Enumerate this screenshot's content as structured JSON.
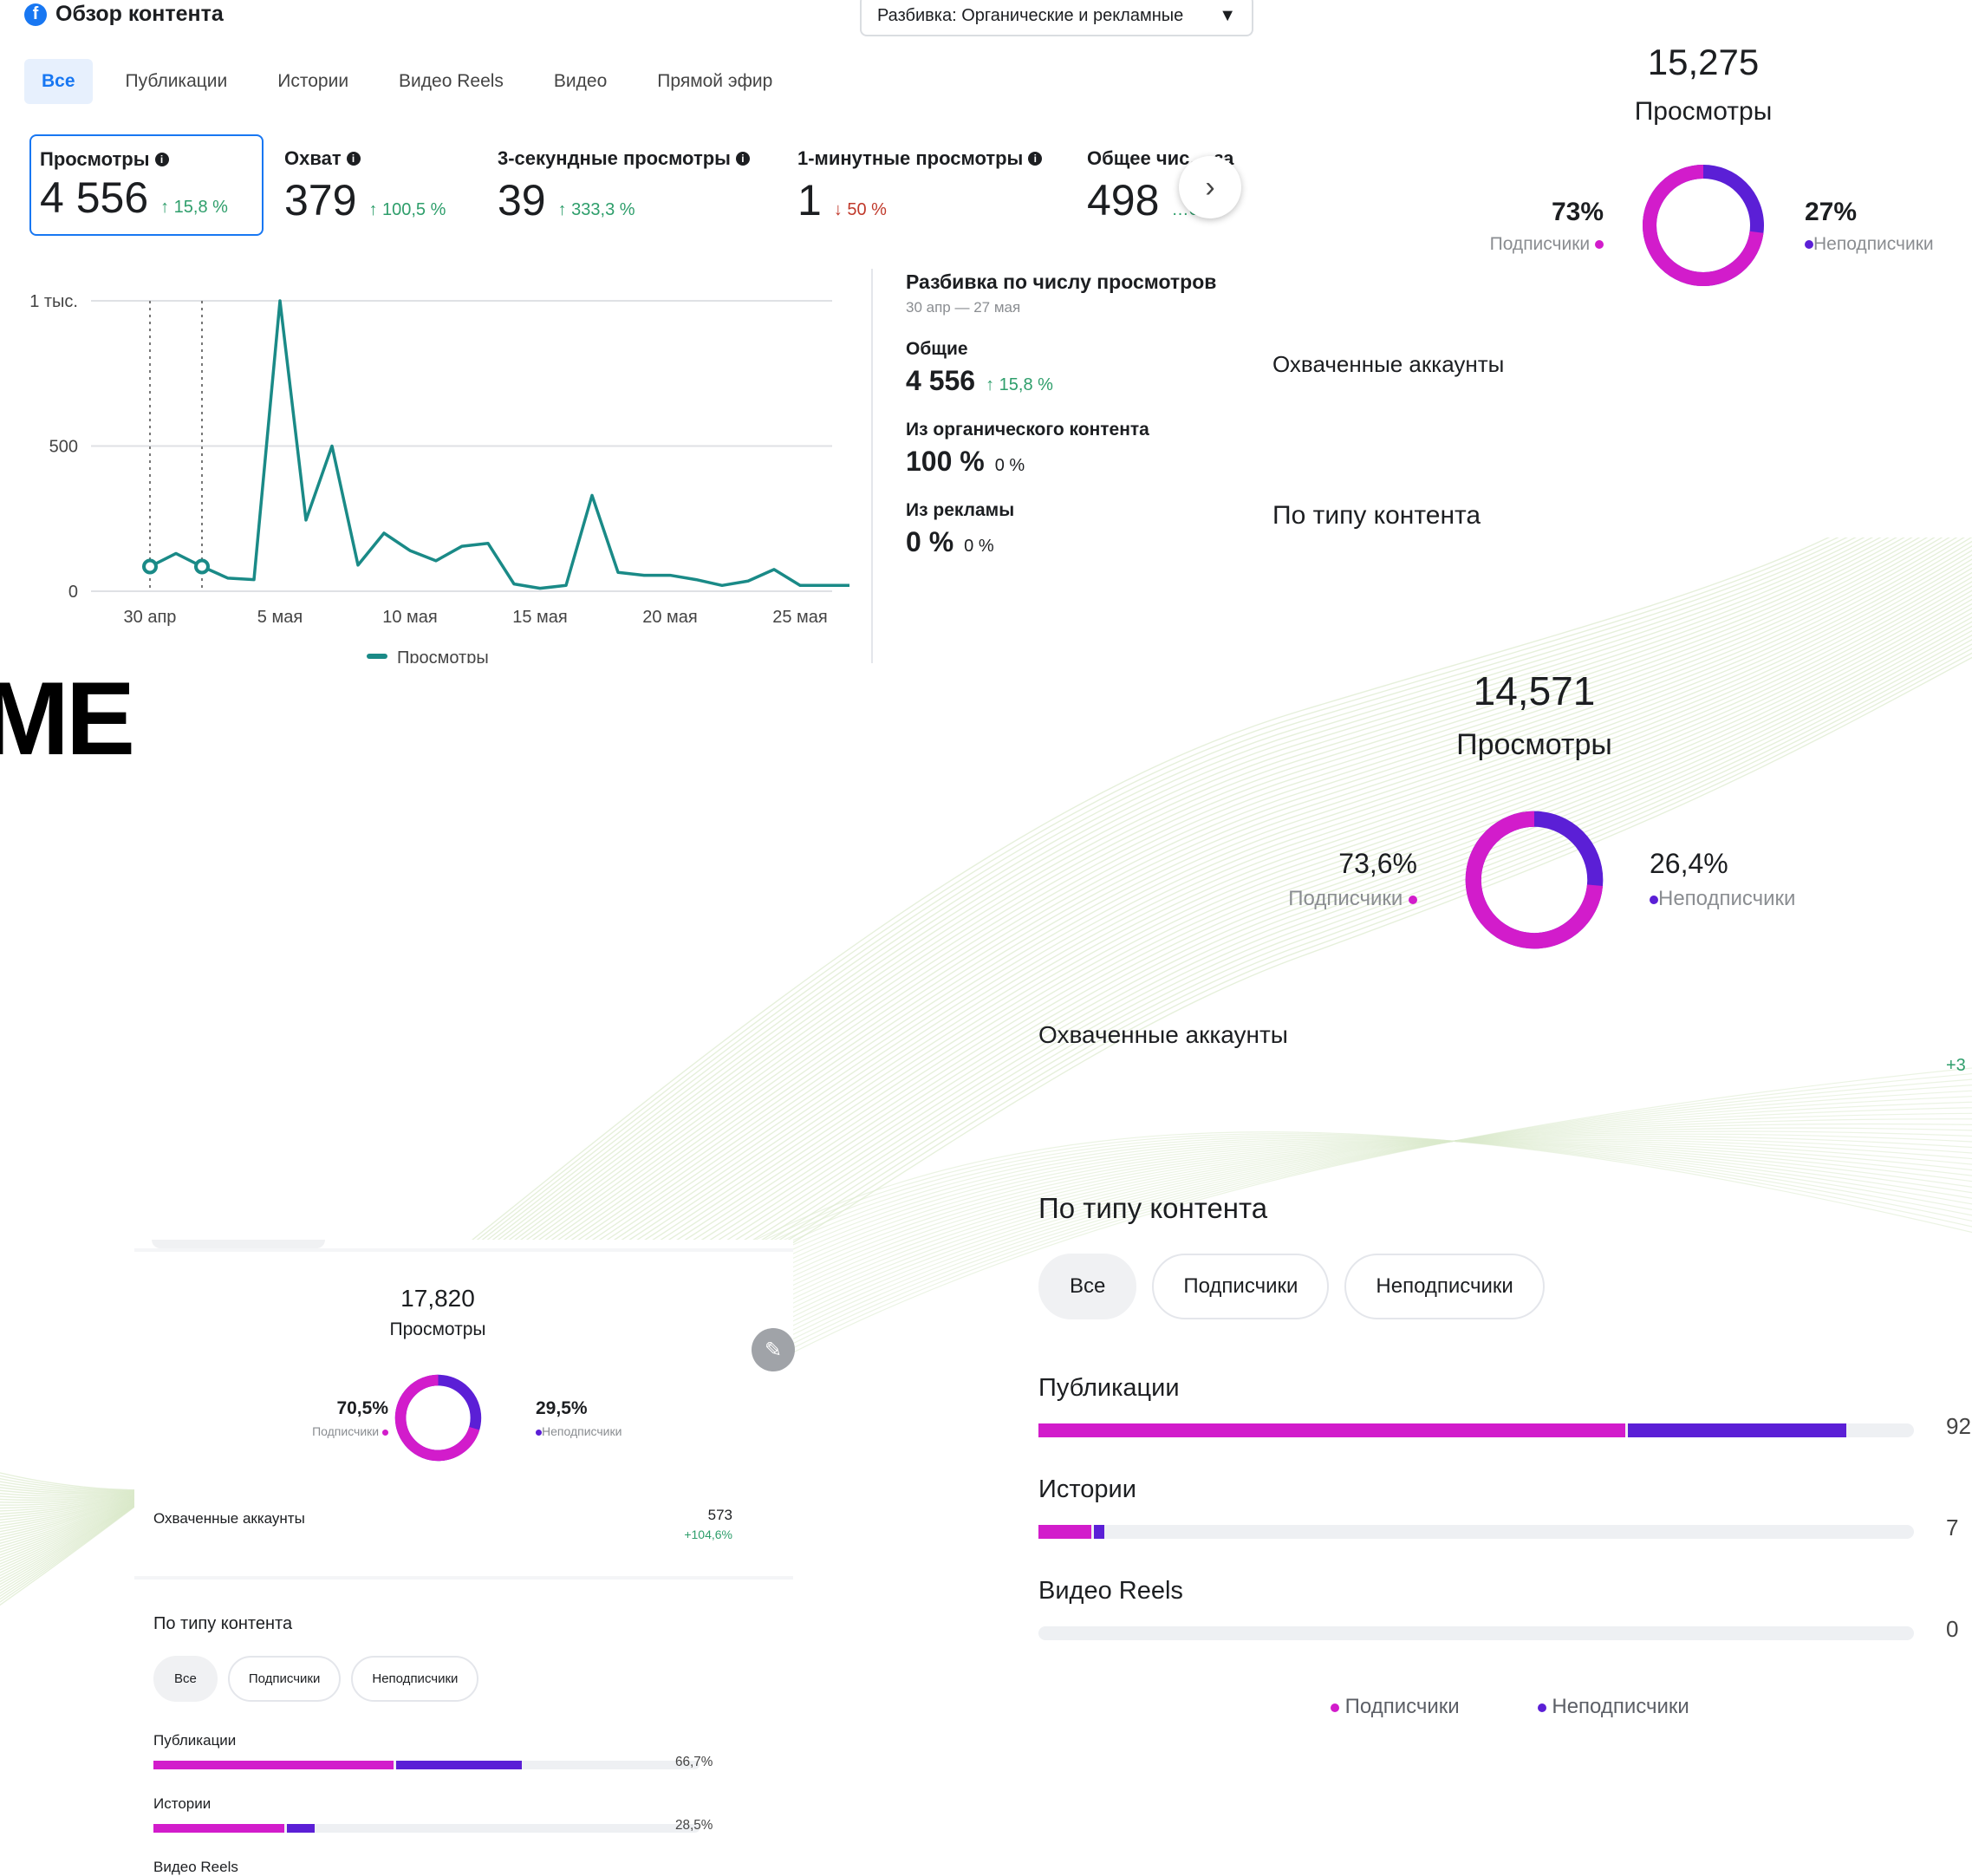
{
  "fb": {
    "title": "Обзор контента",
    "dropdown": "Разбивка: Органические и рекламные",
    "tabs": [
      "Все",
      "Публикации",
      "Истории",
      "Видео Reels",
      "Видео",
      "Прямой эфир"
    ],
    "metrics": [
      {
        "label": "Просмотры",
        "value": "4 556",
        "change": "↑ 15,8 %"
      },
      {
        "label": "Охват",
        "value": "379",
        "change": "↑ 100,5 %"
      },
      {
        "label": "3-секундные просмотры",
        "value": "39",
        "change": "↑ 333,3 %"
      },
      {
        "label": "1-минутные просмотры",
        "value": "1",
        "change": "↓ 50 %"
      },
      {
        "label": "Общее чис… за",
        "value": "498",
        "change": "…6 %"
      }
    ],
    "breakdown": {
      "title": "Разбивка по числу просмотров",
      "period": "30 апр — 27 мая",
      "total_label": "Общие",
      "total_value": "4 556",
      "total_change": "↑ 15,8 %",
      "organic_label": "Из органического контента",
      "organic_value": "100 %",
      "organic_change": "0 %",
      "ads_label": "Из рекламы",
      "ads_value": "0 %",
      "ads_change": "0 %"
    },
    "legend": "Просмотры"
  },
  "chart_data": {
    "type": "line",
    "x": [
      "30 апр",
      "1 мая",
      "2 мая",
      "3 мая",
      "4 мая",
      "5 мая",
      "6 мая",
      "7 мая",
      "8 мая",
      "9 мая",
      "10 мая",
      "11 мая",
      "12 мая",
      "13 мая",
      "14 мая",
      "15 мая",
      "16 мая",
      "17 мая",
      "18 мая",
      "19 мая",
      "20 мая",
      "21 мая",
      "22 мая",
      "23 мая",
      "24 мая",
      "25 мая",
      "26 мая",
      "27 мая"
    ],
    "series": [
      {
        "name": "Просмотры",
        "values": [
          85,
          130,
          85,
          45,
          40,
          1000,
          245,
          500,
          90,
          200,
          140,
          105,
          155,
          165,
          25,
          10,
          20,
          330,
          65,
          55,
          55,
          40,
          20,
          35,
          75,
          20,
          20,
          20
        ]
      }
    ],
    "x_ticks": [
      "30 апр",
      "5 мая",
      "10 мая",
      "15 мая",
      "20 мая",
      "25 мая"
    ],
    "y_ticks": [
      "0",
      "500",
      "1 тыс."
    ],
    "ylim": [
      0,
      1000
    ],
    "color": "#1a8a87",
    "grid": true
  },
  "big_letters": "ME",
  "donut1": {
    "value": "15,275",
    "caption": "Просмотры",
    "left_pct": "73%",
    "left_label": "Подписчики",
    "right_pct": "27%",
    "right_label": "Неподписчики",
    "fraction": 0.73,
    "reached": "Охваченные аккаунты",
    "section": "По типу контента"
  },
  "donut2": {
    "value": "14,571",
    "caption": "Просмотры",
    "left_pct": "73,6%",
    "left_label": "Подписчики",
    "right_pct": "26,4%",
    "right_label": "Неподписчики",
    "fraction": 0.736,
    "reached": "Охваченные аккаунты",
    "reached_change": "+3",
    "section": "По типу контента",
    "pills": [
      "Все",
      "Подписчики",
      "Неподписчики"
    ],
    "rows": [
      {
        "label": "Публикации",
        "m": 0.67,
        "p": 0.25,
        "value": "92"
      },
      {
        "label": "Истории",
        "m": 0.06,
        "p": 0.012,
        "value": "7"
      },
      {
        "label": "Видео Reels",
        "m": 0.0,
        "p": 0.0,
        "value": "0"
      }
    ],
    "legend_m": "Подписчики",
    "legend_p": "Неподписчики"
  },
  "card": {
    "value": "17,820",
    "caption": "Просмотры",
    "left_pct": "70,5%",
    "left_label": "Подписчики",
    "right_pct": "29,5%",
    "right_label": "Неподписчики",
    "fraction": 0.705,
    "reached": "Охваченные аккаунты",
    "reached_value": "573",
    "reached_change": "+104,6%",
    "section": "По типу контента",
    "pills": [
      "Все",
      "Подписчики",
      "Неподписчики"
    ],
    "rows": [
      {
        "label": "Публикации",
        "m": 0.44,
        "p": 0.23,
        "value": "66,7%"
      },
      {
        "label": "Истории",
        "m": 0.24,
        "p": 0.05,
        "value": "28,5%"
      },
      {
        "label": "Видео Reels",
        "m": 0,
        "p": 0,
        "value": ""
      }
    ]
  },
  "colors": {
    "subscribers": "#d21ccb",
    "non_subscribers": "#5b1fd6",
    "fb_blue": "#1877f2",
    "line": "#1a8a87"
  }
}
